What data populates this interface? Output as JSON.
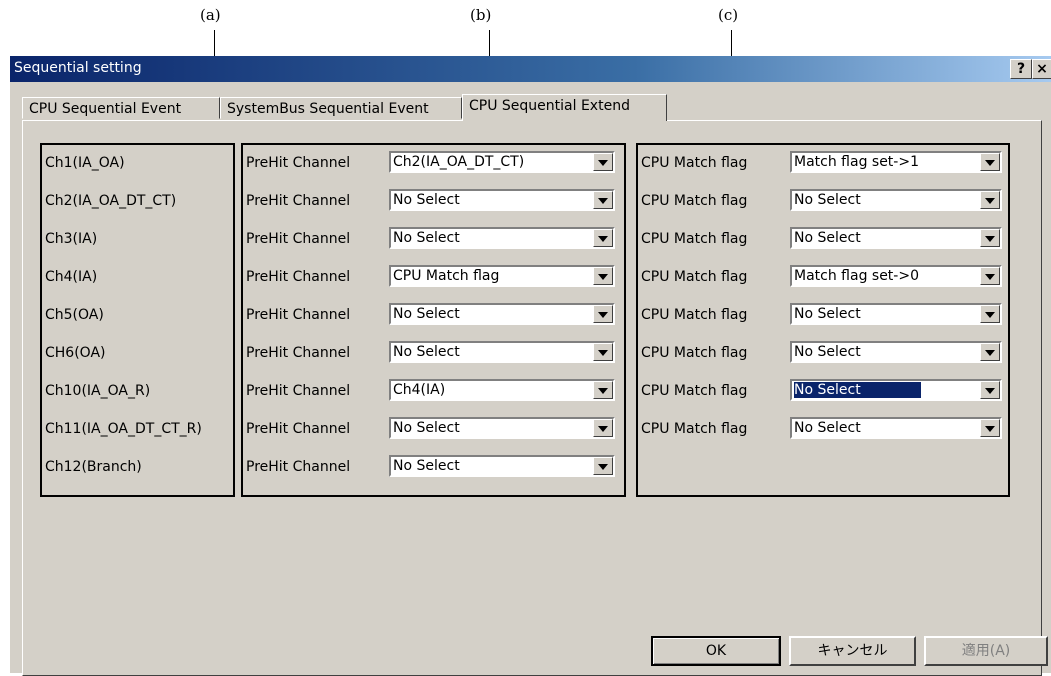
{
  "callouts": [
    "(a)",
    "(b)",
    "(c)"
  ],
  "window": {
    "title": "Sequential setting",
    "help_label": "?",
    "close_label": "×"
  },
  "tabs": [
    "CPU Sequential Event",
    "SystemBus Sequential Event",
    "CPU Sequential Extend"
  ],
  "active_tab": 2,
  "channels": [
    "Ch1(IA_OA)",
    "Ch2(IA_OA_DT_CT)",
    "Ch3(IA)",
    "Ch4(IA)",
    "Ch5(OA)",
    "CH6(OA)",
    "Ch10(IA_OA_R)",
    "Ch11(IA_OA_DT_CT_R)",
    "Ch12(Branch)"
  ],
  "prehit": {
    "label": "PreHit Channel",
    "values": [
      "Ch2(IA_OA_DT_CT)",
      "No Select",
      "No Select",
      "CPU Match flag",
      "No Select",
      "No Select",
      "Ch4(IA)",
      "No Select",
      "No Select"
    ]
  },
  "match": {
    "label": "CPU Match flag",
    "values": [
      "Match flag set->1",
      "No Select",
      "No Select",
      "Match flag set->0",
      "No Select",
      "No Select",
      "No Select",
      "No Select"
    ],
    "selected_index": 6
  },
  "buttons": {
    "ok": "OK",
    "cancel": "キャンセル",
    "apply": "適用(A)"
  }
}
